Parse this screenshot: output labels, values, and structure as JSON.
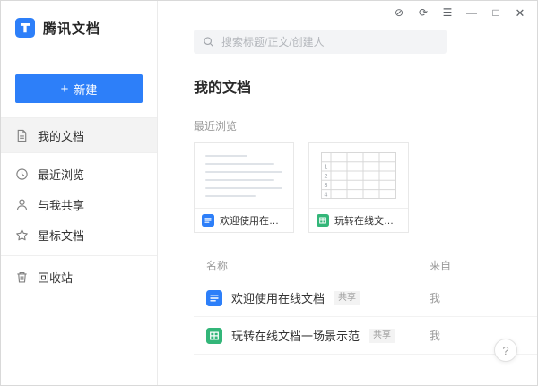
{
  "window": {
    "controls": {
      "incognito": "⊘",
      "refresh": "⟳",
      "menu": "☰",
      "minimize": "—",
      "maximize": "□",
      "close": "✕"
    }
  },
  "sidebar": {
    "app_name": "腾讯文档",
    "new_button_plus": "+",
    "new_button_label": "新建",
    "items": [
      {
        "label": "我的文档"
      },
      {
        "label": "最近浏览"
      },
      {
        "label": "与我共享"
      },
      {
        "label": "星标文档"
      },
      {
        "label": "回收站"
      }
    ]
  },
  "search": {
    "placeholder": "搜索标题/正文/创建人"
  },
  "main": {
    "page_title": "我的文档",
    "recent_section_title": "最近浏览",
    "recent_cards": [
      {
        "title": "欢迎使用在线文档",
        "type": "doc"
      },
      {
        "title": "玩转在线文档一...",
        "type": "sheet",
        "row_numbers": [
          "1",
          "2",
          "3",
          "4"
        ]
      }
    ],
    "table": {
      "columns": {
        "name": "名称",
        "from": "来自"
      },
      "rows": [
        {
          "name": "欢迎使用在线文档",
          "badge": "共享",
          "from": "我",
          "type": "doc"
        },
        {
          "name": "玩转在线文档一场景示范",
          "badge": "共享",
          "from": "我",
          "type": "sheet"
        }
      ]
    },
    "help_label": "?"
  },
  "colors": {
    "accent_blue": "#2d7ff9",
    "doc_blue": "#2d7ff9",
    "sheet_green": "#33b679",
    "active_item_bg": "#f3f3f3"
  }
}
